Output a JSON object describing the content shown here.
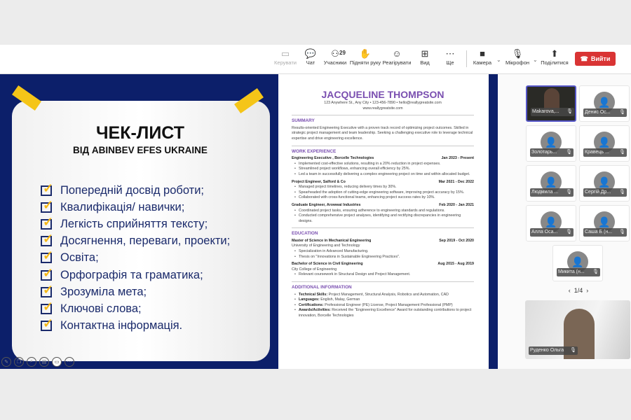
{
  "toolbar": {
    "items": [
      {
        "label": "Керувати",
        "icon": "screen-control-icon",
        "disabled": true
      },
      {
        "label": "Чат",
        "icon": "chat-icon"
      },
      {
        "label": "Учасники",
        "icon": "people-icon",
        "count": "29"
      },
      {
        "label": "Підняти руку",
        "icon": "raise-hand-icon"
      },
      {
        "label": "Реагірувати",
        "icon": "smiley-icon"
      },
      {
        "label": "Вид",
        "icon": "grid-icon"
      },
      {
        "label": "Ще",
        "icon": "more-icon"
      },
      {
        "label": "Камера",
        "icon": "camera-icon"
      },
      {
        "label": "Мікрофон",
        "icon": "mic-off-icon"
      },
      {
        "label": "Поділитися",
        "icon": "share-icon"
      }
    ],
    "leave_label": "Вийти",
    "leave_color": "#d93434"
  },
  "slide": {
    "title": "ЧЕК-ЛИСТ",
    "subtitle": "ВІД ABINBEV EFES UKRAINE",
    "items": [
      "Попередній досвід роботи;",
      "Квалифікація/ навички;",
      "Легкість сприйняття тексту;",
      "Досягнення, переваги, проекти;",
      "Освіта;",
      "Орфографія та граматика;",
      "Зрозуміла мета;",
      "Ключові слова;",
      "Контактна інформація."
    ],
    "bg_color": "#0c1f6a",
    "accent": "#f5c518"
  },
  "resume": {
    "name": "JACQUELINE THOMPSON",
    "contact": "123 Anywhere St., Any City • 123-456-7890 • hello@reallygreatsite.com",
    "website": "www.reallygreatsite.com",
    "summary_title": "SUMMARY",
    "summary": "Results-oriented Engineering Executive with a proven track record of optimizing project outcomes. Skilled in strategic project management and team leadership. Seeking a challenging executive role to leverage technical expertise and drive engineering excellence.",
    "work_title": "WORK EXPERIENCE",
    "jobs": [
      {
        "title": "Engineering Executive , Borcelle Technologies",
        "dates": "Jan 2023 - Present",
        "bullets": [
          "Implemented cost-effective solutions, resulting in a 20% reduction in project expenses.",
          "Streamlined project workflows, enhancing overall efficiency by 25%.",
          "Led a team in successfully delivering a complex engineering project on time and within allocated budget."
        ]
      },
      {
        "title": "Project Engineer, Salford & Co",
        "dates": "Mar 2021 - Dec 2022",
        "bullets": [
          "Managed project timelines, reducing delivery times by 30%.",
          "Spearheaded the adoption of cutting-edge engineering software, improving project accuracy by 15%.",
          "Collaborated with cross-functional teams, enhancing project success rates by 10%."
        ]
      },
      {
        "title": "Graduate Engineer, Arowwai Industries",
        "dates": "Feb 2020 - Jan 2021",
        "bullets": [
          "Coordinated project tasks, ensuring adherence to engineering standards and regulations.",
          "Conducted comprehensive project analyses, identifying and rectifying discrepancies in engineering designs."
        ]
      }
    ],
    "education_title": "EDUCATION",
    "education": [
      {
        "title": "Master of Science in Mechanical Engineering",
        "dates": "Sep 2019 - Oct 2020",
        "school": "University of Engineering and Technology",
        "bullets": [
          "Specialization in Advanced Manufacturing.",
          "Thesis on \"Innovations in Sustainable Engineering Practices\"."
        ]
      },
      {
        "title": "Bachelor of Science in Civil Engineering",
        "dates": "Aug 2015 - Aug 2019",
        "school": "City College of Engineering",
        "bullets": [
          "Relevant coursework in Structural Design and Project Management."
        ]
      }
    ],
    "additional_title": "ADDITIONAL INFORMATION",
    "additional": [
      {
        "label": "Technical Skills:",
        "text": " Project Management, Structural Analysis, Robotics and Automation, CAD"
      },
      {
        "label": "Languages:",
        "text": " English, Malay, German"
      },
      {
        "label": "Certifications:",
        "text": " Professional Engineer (PE) License, Project Management Professional (PMP)"
      },
      {
        "label": "Awards/Activities:",
        "text": " Received the \"Engineering Excellence\" Award for outstanding contributions to project innovation, Borcelle Technologies"
      }
    ],
    "accent": "#7a4fb0"
  },
  "participants": [
    {
      "name": "Makarova,...",
      "video": true,
      "muted": false
    },
    {
      "name": "Денис Ос...",
      "muted": true
    },
    {
      "name": "Золотарь...",
      "muted": true
    },
    {
      "name": "Кравець ...",
      "muted": true
    },
    {
      "name": "Людмила ...",
      "muted": true
    },
    {
      "name": "Сергій Др...",
      "muted": true
    },
    {
      "name": "Алла Оса...",
      "muted": true
    },
    {
      "name": "Саша Б (н...",
      "muted": true
    },
    {
      "name": "Микита (н...",
      "muted": true
    }
  ],
  "pager": "1/4",
  "speaker": {
    "name": "Руденко Ольга",
    "muted": true
  }
}
